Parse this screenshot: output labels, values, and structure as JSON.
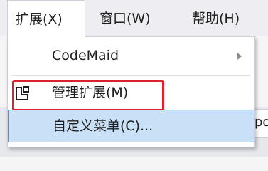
{
  "menubar": {
    "items": [
      {
        "label": "扩展(X)",
        "active": true
      },
      {
        "label": "窗口(W)",
        "active": false
      },
      {
        "label": "帮助(H)",
        "active": false
      }
    ]
  },
  "dropdown": {
    "items": [
      {
        "label": "CodeMaid",
        "submenu": true,
        "icon": null
      },
      {
        "label": "管理扩展(M)",
        "submenu": false,
        "icon": "manage-extensions-icon"
      },
      {
        "label": "自定义菜单(C)...",
        "submenu": false,
        "icon": null,
        "hovered": true
      }
    ]
  },
  "background": {
    "partial_tab_text": "po"
  },
  "colors": {
    "menubar_bg": "#eeeef2",
    "dropdown_bg": "#ffffff",
    "hover_bg": "#c9e0f7",
    "hover_border": "#3399ff",
    "highlight_box": "#e0202a"
  }
}
